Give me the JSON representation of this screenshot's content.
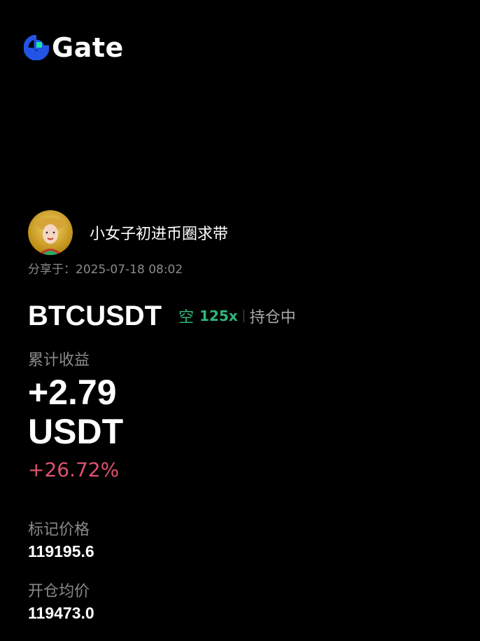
{
  "brand": {
    "name": "Gate",
    "colors": {
      "logo_blue": "#2354e6",
      "logo_green": "#17e6a1"
    }
  },
  "user": {
    "avatar_icon": "user-avatar-photo",
    "name": "小女子初进币圈求带"
  },
  "share": {
    "text": "分享于：2025-07-18 08:02"
  },
  "position": {
    "pair": "BTCUSDT",
    "direction": "空",
    "leverage": "125x",
    "status": "持仓中",
    "direction_color": "#2fb67a"
  },
  "pnl": {
    "label": "累计收益",
    "value": "+2.79",
    "unit": "USDT",
    "percent": "+26.72%",
    "percent_color": "#e0516e"
  },
  "mark_price": {
    "label": "标记价格",
    "value": "119195.6"
  },
  "entry_price": {
    "label": "开仓均价",
    "value": "119473.0"
  }
}
